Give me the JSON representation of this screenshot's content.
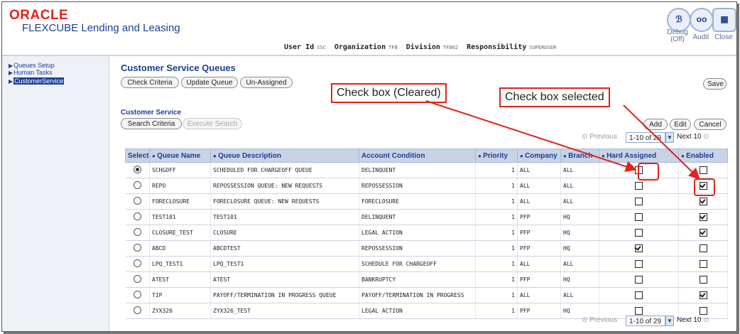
{
  "header": {
    "brand": "ORACLE",
    "product": "FLEXCUBE Lending and Leasing",
    "tools": [
      {
        "label": "Debug",
        "sublabel": "(Off)",
        "icon": "debug-icon"
      },
      {
        "label": "Audit",
        "icon": "audit-icon"
      },
      {
        "label": "Close",
        "icon": "close-icon"
      }
    ],
    "user": {
      "user_id_label": "User Id",
      "user_id": "SSC",
      "org_label": "Organization",
      "org": "TFB",
      "division_label": "Division",
      "division": "TFB02",
      "resp_label": "Responsibility",
      "resp": "SUPERUSER"
    }
  },
  "sidebar": {
    "items": [
      {
        "label": "Queues Setup"
      },
      {
        "label": "Human Tasks"
      },
      {
        "label": "CustomerService",
        "selected": true
      }
    ]
  },
  "page": {
    "title": "Customer Service Queues",
    "buttons": {
      "check_criteria": "Check Criteria",
      "update_queue": "Update Queue",
      "unassigned": "Un-Assigned",
      "save": "Save"
    },
    "section_title": "Customer Service",
    "search_buttons": {
      "search_criteria": "Search Criteria",
      "execute_search": "Execute Search"
    },
    "grid_buttons": {
      "add": "Add",
      "edit": "Edit",
      "cancel": "Cancel"
    },
    "pager": {
      "previous": "Previous",
      "range": "1-10 of 29",
      "next": "Next 10"
    }
  },
  "callouts": {
    "cleared": "Check box (Cleared)",
    "selected": "Check box selected"
  },
  "table": {
    "columns": [
      "Select",
      "Queue Name",
      "Queue Description",
      "Account Condition",
      "Priority",
      "Company",
      "Branch",
      "Hard Assigned",
      "Enabled"
    ],
    "rows": [
      {
        "selected": true,
        "name": "SCHGOFF",
        "desc": "SCHEDULED FOR CHARGEOFF QUEUE",
        "cond": "DELINQUENT",
        "priority": "1",
        "company": "ALL",
        "branch": "ALL",
        "hard": false,
        "enabled": false
      },
      {
        "selected": false,
        "name": "REPO",
        "desc": "REPOSSESSION QUEUE: NEW REQUESTS",
        "cond": "REPOSSESSION",
        "priority": "1",
        "company": "ALL",
        "branch": "ALL",
        "hard": false,
        "enabled": true
      },
      {
        "selected": false,
        "name": "FORECLOSURE",
        "desc": "FORECLOSURE QUEUE: NEW REQUESTS",
        "cond": "FORECLOSURE",
        "priority": "1",
        "company": "ALL",
        "branch": "ALL",
        "hard": false,
        "enabled": true
      },
      {
        "selected": false,
        "name": "TEST101",
        "desc": "TEST101",
        "cond": "DELINQUENT",
        "priority": "1",
        "company": "PFP",
        "branch": "HQ",
        "hard": false,
        "enabled": true
      },
      {
        "selected": false,
        "name": "CLOSURE_TEST",
        "desc": "CLOSURE",
        "cond": "LEGAL ACTION",
        "priority": "1",
        "company": "PFP",
        "branch": "HQ",
        "hard": false,
        "enabled": true
      },
      {
        "selected": false,
        "name": "ABCD",
        "desc": "ABCDTEST",
        "cond": "REPOSSESSION",
        "priority": "1",
        "company": "PFP",
        "branch": "HQ",
        "hard": true,
        "enabled": false
      },
      {
        "selected": false,
        "name": "LPQ_TEST1",
        "desc": "LPQ_TEST1",
        "cond": "SCHEDULE FOR CHARGEOFF",
        "priority": "1",
        "company": "ALL",
        "branch": "ALL",
        "hard": false,
        "enabled": false
      },
      {
        "selected": false,
        "name": "ATEST",
        "desc": "ATEST",
        "cond": "BANKRUPTCY",
        "priority": "1",
        "company": "PFP",
        "branch": "HQ",
        "hard": false,
        "enabled": false
      },
      {
        "selected": false,
        "name": "TIP",
        "desc": "PAYOFF/TERMINATION IN PROGRESS QUEUE",
        "cond": "PAYOFF/TERMINATION IN PROGRESS",
        "priority": "1",
        "company": "ALL",
        "branch": "ALL",
        "hard": false,
        "enabled": true
      },
      {
        "selected": false,
        "name": "ZYX326",
        "desc": "ZYX326_TEST",
        "cond": "LEGAL ACTION",
        "priority": "1",
        "company": "PFP",
        "branch": "HQ",
        "hard": false,
        "enabled": false
      }
    ]
  },
  "colors": {
    "brand_red": "#e2231a",
    "nav_blue": "#1c3f94",
    "header_row": "#c9d3e6"
  }
}
